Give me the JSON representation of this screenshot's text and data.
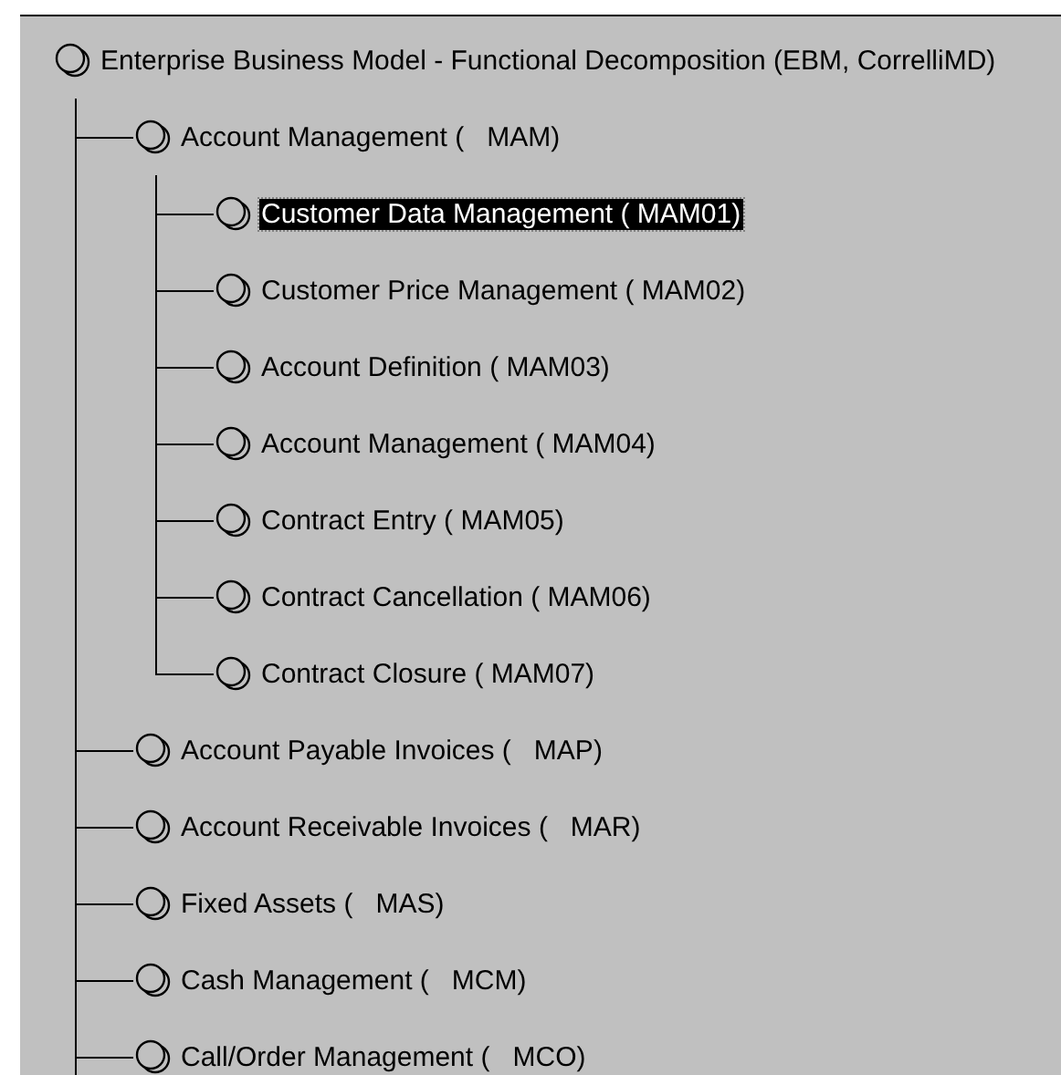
{
  "tree": {
    "label": "Enterprise Business Model - Functional Decomposition (EBM, CorrelliMD)",
    "selected": false,
    "more_below": true,
    "children": [
      {
        "label": "Account Management (   MAM)",
        "selected": false,
        "children": [
          {
            "label": "Customer Data Management ( MAM01)",
            "selected": true
          },
          {
            "label": "Customer Price Management ( MAM02)",
            "selected": false
          },
          {
            "label": "Account Definition ( MAM03)",
            "selected": false
          },
          {
            "label": "Account Management ( MAM04)",
            "selected": false
          },
          {
            "label": "Contract Entry ( MAM05)",
            "selected": false
          },
          {
            "label": "Contract Cancellation ( MAM06)",
            "selected": false
          },
          {
            "label": "Contract Closure ( MAM07)",
            "selected": false
          }
        ]
      },
      {
        "label": "Account Payable Invoices (   MAP)",
        "selected": false
      },
      {
        "label": "Account Receivable Invoices (   MAR)",
        "selected": false
      },
      {
        "label": "Fixed Assets (   MAS)",
        "selected": false
      },
      {
        "label": "Cash Management (   MCM)",
        "selected": false
      },
      {
        "label": "Call/Order Management (   MCO)",
        "selected": false
      }
    ]
  }
}
